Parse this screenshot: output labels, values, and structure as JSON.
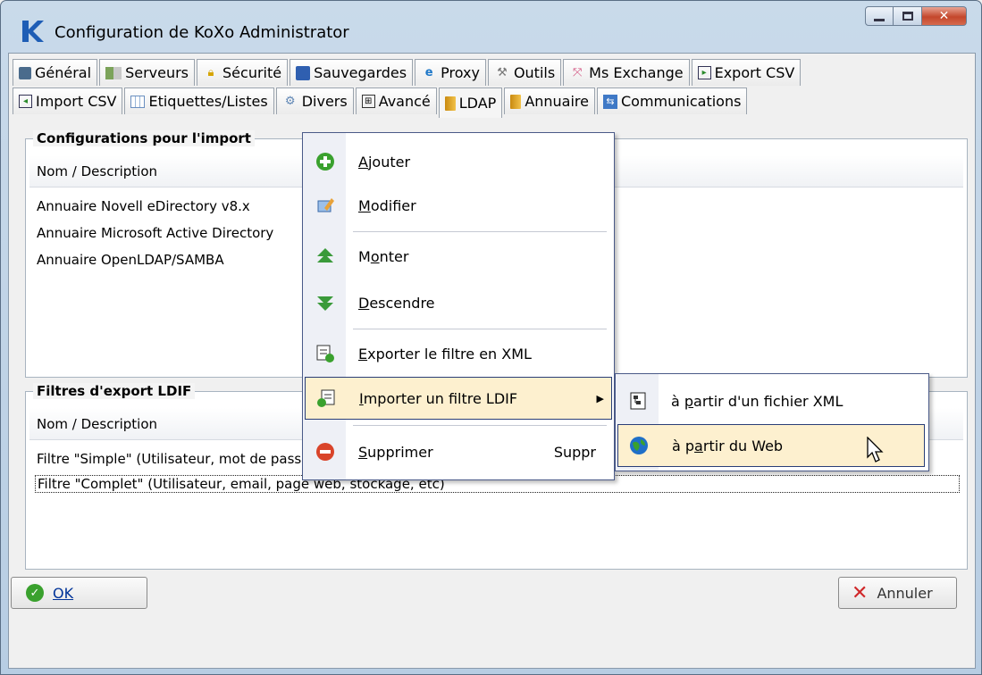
{
  "window": {
    "title": "Configuration de KoXo Administrator",
    "icon": "koxo-logo-icon",
    "controls": [
      "minimize-icon",
      "maximize-icon",
      "close-icon"
    ]
  },
  "tabs_row1": [
    {
      "label": "Général",
      "icon": "general-icon"
    },
    {
      "label": "Serveurs",
      "icon": "servers-icon"
    },
    {
      "label": "Sécurité",
      "icon": "lock-icon"
    },
    {
      "label": "Sauvegardes",
      "icon": "floppy-icon"
    },
    {
      "label": "Proxy",
      "icon": "globe-icon"
    },
    {
      "label": "Outils",
      "icon": "tools-icon"
    },
    {
      "label": "Ms Exchange",
      "icon": "exchange-icon"
    },
    {
      "label": "Export CSV",
      "icon": "export-icon"
    }
  ],
  "tabs_row2": [
    {
      "label": "Import CSV",
      "icon": "import-icon"
    },
    {
      "label": "Etiquettes/Listes",
      "icon": "grid-icon"
    },
    {
      "label": "Divers",
      "icon": "gear-icon"
    },
    {
      "label": "Avancé",
      "icon": "tree-icon"
    },
    {
      "label": "LDAP",
      "icon": "book-icon",
      "active": true
    },
    {
      "label": "Annuaire",
      "icon": "book-icon"
    },
    {
      "label": "Communications",
      "icon": "communications-icon"
    }
  ],
  "import_panel": {
    "title": "Configurations pour l'import",
    "column": "Nom / Description",
    "rows": [
      "Annuaire Novell eDirectory v8.x",
      "Annuaire Microsoft Active Directory",
      "Annuaire OpenLDAP/SAMBA"
    ]
  },
  "ldif_panel": {
    "title": "Filtres d'export LDIF",
    "column": "Nom / Description",
    "rows": [
      "Filtre \"Simple\" (Utilisateur, mot de passe)",
      "Filtre \"Complet\" (Utilisateur, email, page web, stockage, etc)"
    ]
  },
  "context_menu": {
    "items": [
      {
        "label_pre": "",
        "label_key": "A",
        "label_post": "jouter",
        "icon": "add-icon"
      },
      {
        "label_pre": "",
        "label_key": "M",
        "label_post": "odifier",
        "icon": "edit-icon"
      },
      {
        "label_pre": "M",
        "label_key": "o",
        "label_post": "nter",
        "icon": "move-up-icon"
      },
      {
        "label_pre": "",
        "label_key": "D",
        "label_post": "escendre",
        "icon": "move-down-icon"
      },
      {
        "label_pre": "",
        "label_key": "E",
        "label_post": "xporter le filtre en XML",
        "icon": "export-xml-icon"
      },
      {
        "label_pre": "",
        "label_key": "I",
        "label_post": "mporter un filtre LDIF",
        "icon": "import-icon"
      },
      {
        "label_pre": "",
        "label_key": "S",
        "label_post": "upprimer",
        "icon": "delete-icon",
        "shortcut": "Suppr"
      }
    ]
  },
  "submenu": {
    "items": [
      {
        "label_pre": "à ",
        "label_key": "p",
        "label_post": "artir d'un fichier XML",
        "icon": "xml-file-icon"
      },
      {
        "label_pre": "à p",
        "label_key": "a",
        "label_post": "rtir du Web",
        "icon": "web-globe-icon"
      }
    ]
  },
  "buttons": {
    "ok": "OK",
    "cancel": "Annuler"
  },
  "colors": {
    "menu_highlight": "#fdf0cf",
    "menu_border": "#2a3e77",
    "ok_text": "#003399"
  }
}
